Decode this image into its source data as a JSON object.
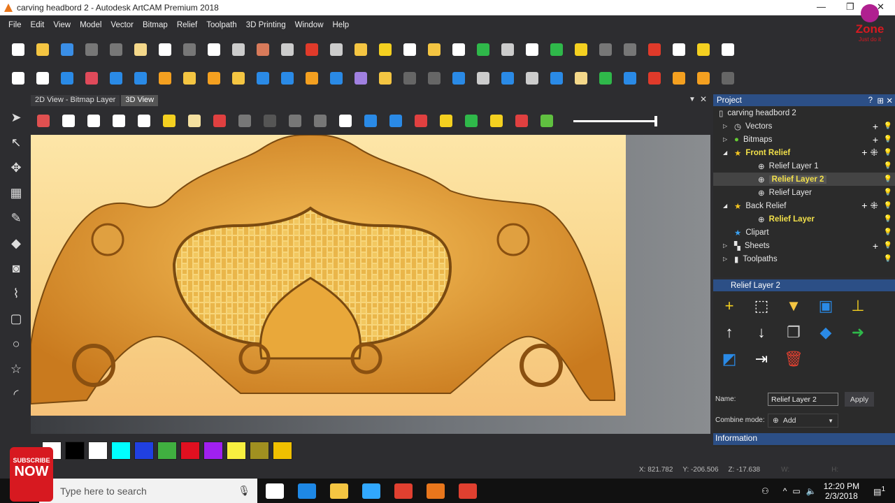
{
  "window": {
    "title": "carving headbord 2 - Autodesk ArtCAM Premium 2018",
    "minimize": "—",
    "maximize": "❐",
    "close": "✕"
  },
  "menu": [
    "File",
    "Edit",
    "View",
    "Model",
    "Vector",
    "Bitmap",
    "Relief",
    "Toolpath",
    "3D Printing",
    "Window",
    "Help"
  ],
  "toolbar1": [
    {
      "icon": "new-file-icon",
      "color": "#ffffff"
    },
    {
      "icon": "open-folder-icon",
      "color": "#f4c542"
    },
    {
      "icon": "save-icon",
      "color": "#3a8ee6"
    },
    {
      "icon": "cut-icon",
      "color": "#777777"
    },
    {
      "icon": "copy-icon",
      "color": "#777777"
    },
    {
      "icon": "paste-icon",
      "color": "#f4d88a"
    },
    {
      "icon": "undo-icon",
      "color": "#ffffff"
    },
    {
      "icon": "redo-icon",
      "color": "#777777"
    },
    {
      "icon": "document-icon",
      "color": "#ffffff"
    },
    {
      "icon": "resize-icon",
      "color": "#cccccc"
    },
    {
      "icon": "bitmap-icon",
      "color": "#d87a5a"
    },
    {
      "icon": "grid-icon",
      "color": "#cccccc"
    },
    {
      "icon": "magnet-icon",
      "color": "#e03a2a"
    },
    {
      "icon": "snap-icon",
      "color": "#cccccc"
    },
    {
      "icon": "folder-star-icon",
      "color": "#f4c542"
    },
    {
      "icon": "arrow-icon",
      "color": "#f4d020"
    },
    {
      "icon": "trim-icon",
      "color": "#ffffff"
    },
    {
      "icon": "curve-icon",
      "color": "#f4c542"
    },
    {
      "icon": "star-icon",
      "color": "#ffffff"
    },
    {
      "icon": "weave-icon",
      "color": "#2fb84a"
    },
    {
      "icon": "shape-icon",
      "color": "#cccccc"
    },
    {
      "icon": "layout-icon",
      "color": "#ffffff"
    },
    {
      "icon": "table-icon",
      "color": "#2fb84a"
    },
    {
      "icon": "relief-icon",
      "color": "#f4d020"
    },
    {
      "icon": "erase-icon",
      "color": "#777777"
    },
    {
      "icon": "vector-icon",
      "color": "#777777"
    },
    {
      "icon": "nodes-icon",
      "color": "#e03a2a"
    },
    {
      "icon": "flower-icon",
      "color": "#ffffff"
    },
    {
      "icon": "wave-icon",
      "color": "#f4d020"
    },
    {
      "icon": "spline-icon",
      "color": "#ffffff"
    }
  ],
  "toolbar2": [
    {
      "icon": "zoom-icon",
      "color": "#ffffff"
    },
    {
      "icon": "gear-icon",
      "color": "#ffffff"
    },
    {
      "icon": "relief-blue-icon",
      "color": "#2a8ae6"
    },
    {
      "icon": "eraser-icon",
      "color": "#e04a5a"
    },
    {
      "icon": "extrude-icon",
      "color": "#2a8ae6"
    },
    {
      "icon": "spin-icon",
      "color": "#2a8ae6"
    },
    {
      "icon": "weave-pattern-icon",
      "color": "#f4a020"
    },
    {
      "icon": "shape-editor-icon",
      "color": "#f4c542"
    },
    {
      "icon": "sculpt-icon",
      "color": "#f4a020"
    },
    {
      "icon": "folder-icon",
      "color": "#f4c542"
    },
    {
      "icon": "plane-icon",
      "color": "#2a8ae6"
    },
    {
      "icon": "split-icon",
      "color": "#2a8ae6"
    },
    {
      "icon": "texture-icon",
      "color": "#f4a020"
    },
    {
      "icon": "upload-icon",
      "color": "#2a8ae6"
    },
    {
      "icon": "layers-icon",
      "color": "#a080e0"
    },
    {
      "icon": "paint-icon",
      "color": "#f4c542"
    },
    {
      "icon": "disabled-icon",
      "color": "#666666"
    },
    {
      "icon": "dots-icon",
      "color": "#666666"
    },
    {
      "icon": "slice-icon",
      "color": "#2a8ae6"
    },
    {
      "icon": "stack-icon",
      "color": "#cccccc"
    },
    {
      "icon": "diamond-icon",
      "color": "#2a8ae6"
    },
    {
      "icon": "bucket-icon",
      "color": "#cccccc"
    },
    {
      "icon": "sheet-icon",
      "color": "#2a8ae6"
    },
    {
      "icon": "layers-stack-icon",
      "color": "#f4d88a"
    },
    {
      "icon": "add-green-icon",
      "color": "#2fb84a"
    },
    {
      "icon": "pot-icon",
      "color": "#2a8ae6"
    },
    {
      "icon": "target-icon",
      "color": "#e03a2a"
    },
    {
      "icon": "arrows-icon",
      "color": "#f4a020"
    },
    {
      "icon": "mirror-icon",
      "color": "#f4a020"
    },
    {
      "icon": "disabled2-icon",
      "color": "#666666"
    }
  ],
  "tabs": [
    "2D View - Bitmap Layer",
    "3D View"
  ],
  "viewtoolbar": [
    {
      "icon": "iso-view-icon",
      "color": "#e05050"
    },
    {
      "icon": "top-view-icon",
      "color": "#ffffff"
    },
    {
      "icon": "front-view-icon",
      "color": "#ffffff"
    },
    {
      "icon": "side-view-icon",
      "color": "#ffffff"
    },
    {
      "icon": "zoom-fit-icon",
      "color": "#ffffff"
    },
    {
      "icon": "light-icon",
      "color": "#f4d020"
    },
    {
      "icon": "plane-view-icon",
      "color": "#f4e0a0"
    },
    {
      "icon": "axes-icon",
      "color": "#e04040"
    },
    {
      "icon": "box-icon",
      "color": "#777777"
    },
    {
      "icon": "cylinder-icon",
      "color": "#555555"
    },
    {
      "icon": "layer-grey-icon",
      "color": "#777777"
    },
    {
      "icon": "layer-grey2-icon",
      "color": "#777777"
    },
    {
      "icon": "select-icon",
      "color": "#ffffff"
    },
    {
      "icon": "move-icon",
      "color": "#2a8ae6"
    },
    {
      "icon": "blue-layer-icon",
      "color": "#2a8ae6"
    },
    {
      "icon": "red-layer-icon",
      "color": "#e04040"
    },
    {
      "icon": "yellow-layer-icon",
      "color": "#f4d020"
    },
    {
      "icon": "green-circles-icon",
      "color": "#2fb84a"
    },
    {
      "icon": "star-zoom-icon",
      "color": "#f4d020"
    },
    {
      "icon": "multi-icon",
      "color": "#e04040"
    },
    {
      "icon": "rainbow-layers-icon",
      "color": "#60c040"
    }
  ],
  "lefttools": [
    {
      "icon": "select-arrow-icon",
      "glyph": "➤"
    },
    {
      "icon": "node-edit-icon",
      "glyph": "↖"
    },
    {
      "icon": "transform-icon",
      "glyph": "✥"
    },
    {
      "icon": "grid-tool-icon",
      "glyph": "▦"
    },
    {
      "icon": "pencil-icon",
      "glyph": "✎"
    },
    {
      "icon": "fill-icon",
      "glyph": "◆"
    },
    {
      "icon": "text-icon",
      "glyph": "◙"
    },
    {
      "icon": "polyline-icon",
      "glyph": "⌇"
    },
    {
      "icon": "rectangle-icon",
      "glyph": "▢"
    },
    {
      "icon": "circle-icon",
      "glyph": "○"
    },
    {
      "icon": "star-tool-icon",
      "glyph": "☆"
    },
    {
      "icon": "arc-icon",
      "glyph": "◜"
    }
  ],
  "palette": [
    "#ffffff",
    "#000000",
    "#ffffff",
    "#00ffff",
    "#2040e0",
    "#40b040",
    "#e01020",
    "#a020f0",
    "#f8f040",
    "#a09020",
    "#f0c000"
  ],
  "project": {
    "title": "Project",
    "help": "?",
    "pin": "⊞",
    "close": "✕",
    "items": [
      {
        "label": "carving headbord 2",
        "level": 0,
        "icon": "document-icon",
        "style": "normal"
      },
      {
        "label": "Vectors",
        "level": 1,
        "icon": "vectors-icon",
        "style": "normal",
        "expander": "▷",
        "actions": "+"
      },
      {
        "label": "Bitmaps",
        "level": 1,
        "icon": "bitmaps-icon",
        "style": "normal",
        "expander": "▷",
        "actions": "+"
      },
      {
        "label": "Front Relief",
        "level": 1,
        "icon": "star-icon",
        "style": "yellow",
        "expander": "◢",
        "actions": "+ ⁜"
      },
      {
        "label": "Relief Layer 1",
        "level": 2,
        "icon": "add-circle-icon",
        "style": "normal"
      },
      {
        "label": "Relief Layer 2",
        "level": 2,
        "icon": "add-circle-icon",
        "style": "selected"
      },
      {
        "label": "Relief Layer",
        "level": 2,
        "icon": "add-circle-icon",
        "style": "normal"
      },
      {
        "label": "Back Relief",
        "level": 1,
        "icon": "star-icon",
        "style": "normal",
        "expander": "◢",
        "actions": "+ ⁜"
      },
      {
        "label": "Relief Layer",
        "level": 2,
        "icon": "add-circle-icon",
        "style": "yellow"
      },
      {
        "label": "Clipart",
        "level": 1,
        "icon": "blue-star-icon",
        "style": "normal"
      },
      {
        "label": "Sheets",
        "level": 1,
        "icon": "sheets-icon",
        "style": "normal",
        "expander": "▷",
        "actions": "+"
      },
      {
        "label": "Toolpaths",
        "level": 1,
        "icon": "toolpaths-icon",
        "style": "normal",
        "expander": "▷"
      }
    ]
  },
  "layerpanel": {
    "title": "Relief Layer 2",
    "icons": [
      {
        "icon": "add-layer-icon",
        "glyph": "+",
        "color": "#f4d020"
      },
      {
        "icon": "select-region-icon",
        "glyph": "⬚",
        "color": "#ffffff"
      },
      {
        "icon": "import-icon",
        "glyph": "▼",
        "color": "#f4c542"
      },
      {
        "icon": "save-layer-icon",
        "glyph": "▣",
        "color": "#2a8ae6"
      },
      {
        "icon": "flatten-icon",
        "glyph": "⊥",
        "color": "#f4d020"
      },
      {
        "icon": "move-up-icon",
        "glyph": "↑",
        "color": "#ffffff"
      },
      {
        "icon": "move-down-icon",
        "glyph": "↓",
        "color": "#ffffff"
      },
      {
        "icon": "copy-layer-icon",
        "glyph": "❐",
        "color": "#cccccc"
      },
      {
        "icon": "merge-icon",
        "glyph": "◆",
        "color": "#2a8ae6"
      },
      {
        "icon": "combine-icon",
        "glyph": "➜",
        "color": "#2fb84a"
      },
      {
        "icon": "edit-layer-icon",
        "glyph": "◩",
        "color": "#2a8ae6"
      },
      {
        "icon": "transfer-icon",
        "glyph": "⇥",
        "color": "#ffffff"
      },
      {
        "icon": "delete-icon",
        "glyph": "🗑",
        "color": "#e04030"
      }
    ],
    "name_label": "Name:",
    "name_value": "Relief Layer 2",
    "apply": "Apply",
    "combine_label": "Combine mode:",
    "combine_value": "Add",
    "info": "Information"
  },
  "status": {
    "x": "X: 821.782",
    "y": "Y: -206.506",
    "z": "Z: -17.638",
    "w": "W:",
    "h": "H:"
  },
  "taskbar": {
    "search_placeholder": "Type here to search",
    "time": "12:20 PM",
    "date": "2/3/2018",
    "notifications": "1",
    "apps": [
      {
        "icon": "task-view-icon",
        "color": "#ffffff"
      },
      {
        "icon": "edge-icon",
        "color": "#1e88e5"
      },
      {
        "icon": "file-explorer-icon",
        "color": "#f4c542"
      },
      {
        "icon": "photoshop-icon",
        "color": "#31a8ff"
      },
      {
        "icon": "chrome-icon",
        "color": "#e04030"
      },
      {
        "icon": "artcam-icon",
        "color": "#e8761c"
      },
      {
        "icon": "chrome2-icon",
        "color": "#e04030"
      }
    ]
  },
  "overlay": {
    "subscribe": "SUBSCRIBE",
    "now": "NOW",
    "zone": "Zone",
    "zone_tag": "Just do it"
  }
}
